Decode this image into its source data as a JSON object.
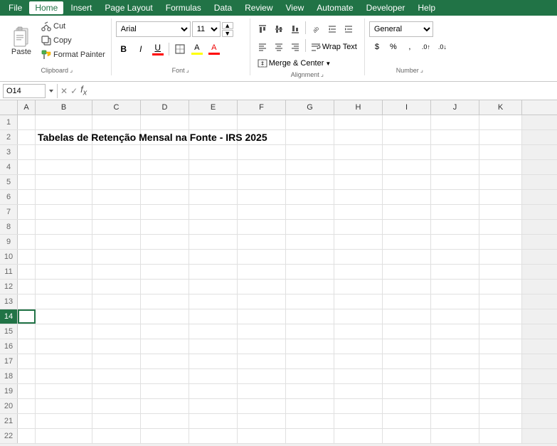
{
  "menu": {
    "items": [
      "File",
      "Home",
      "Insert",
      "Page Layout",
      "Formulas",
      "Data",
      "Review",
      "View",
      "Automate",
      "Developer",
      "Help"
    ],
    "active": "Home"
  },
  "clipboard": {
    "paste_label": "Paste",
    "cut_label": "Cut",
    "copy_label": "Copy",
    "format_painter_label": "Format Painter"
  },
  "font": {
    "family": "Arial",
    "size": "11",
    "bold": "B",
    "italic": "I",
    "underline": "U",
    "border": "⊞",
    "fill_color": "A",
    "font_color": "A",
    "group_label": "Font"
  },
  "alignment": {
    "group_label": "Alignment",
    "wrap_text": "Wrap Text",
    "merge_center": "Merge & Center"
  },
  "number": {
    "format": "General",
    "group_label": "Number",
    "percent": "%",
    "comma": ",",
    "currency": "$",
    "decimal_inc": ".0",
    "decimal_dec": ".00"
  },
  "formula_bar": {
    "cell_ref": "O14",
    "formula": ""
  },
  "columns": [
    "A",
    "B",
    "C",
    "D",
    "E",
    "F",
    "G",
    "H",
    "I",
    "J",
    "K"
  ],
  "rows": [
    "1",
    "2",
    "3",
    "4",
    "5",
    "6",
    "7",
    "8",
    "9",
    "10",
    "11",
    "12",
    "13",
    "14",
    "15",
    "16",
    "17",
    "18",
    "19",
    "20",
    "21",
    "22"
  ],
  "cell_content": {
    "row": 2,
    "col": 1,
    "text": "Tabelas de Retenção Mensal na Fonte - IRS 2025"
  }
}
